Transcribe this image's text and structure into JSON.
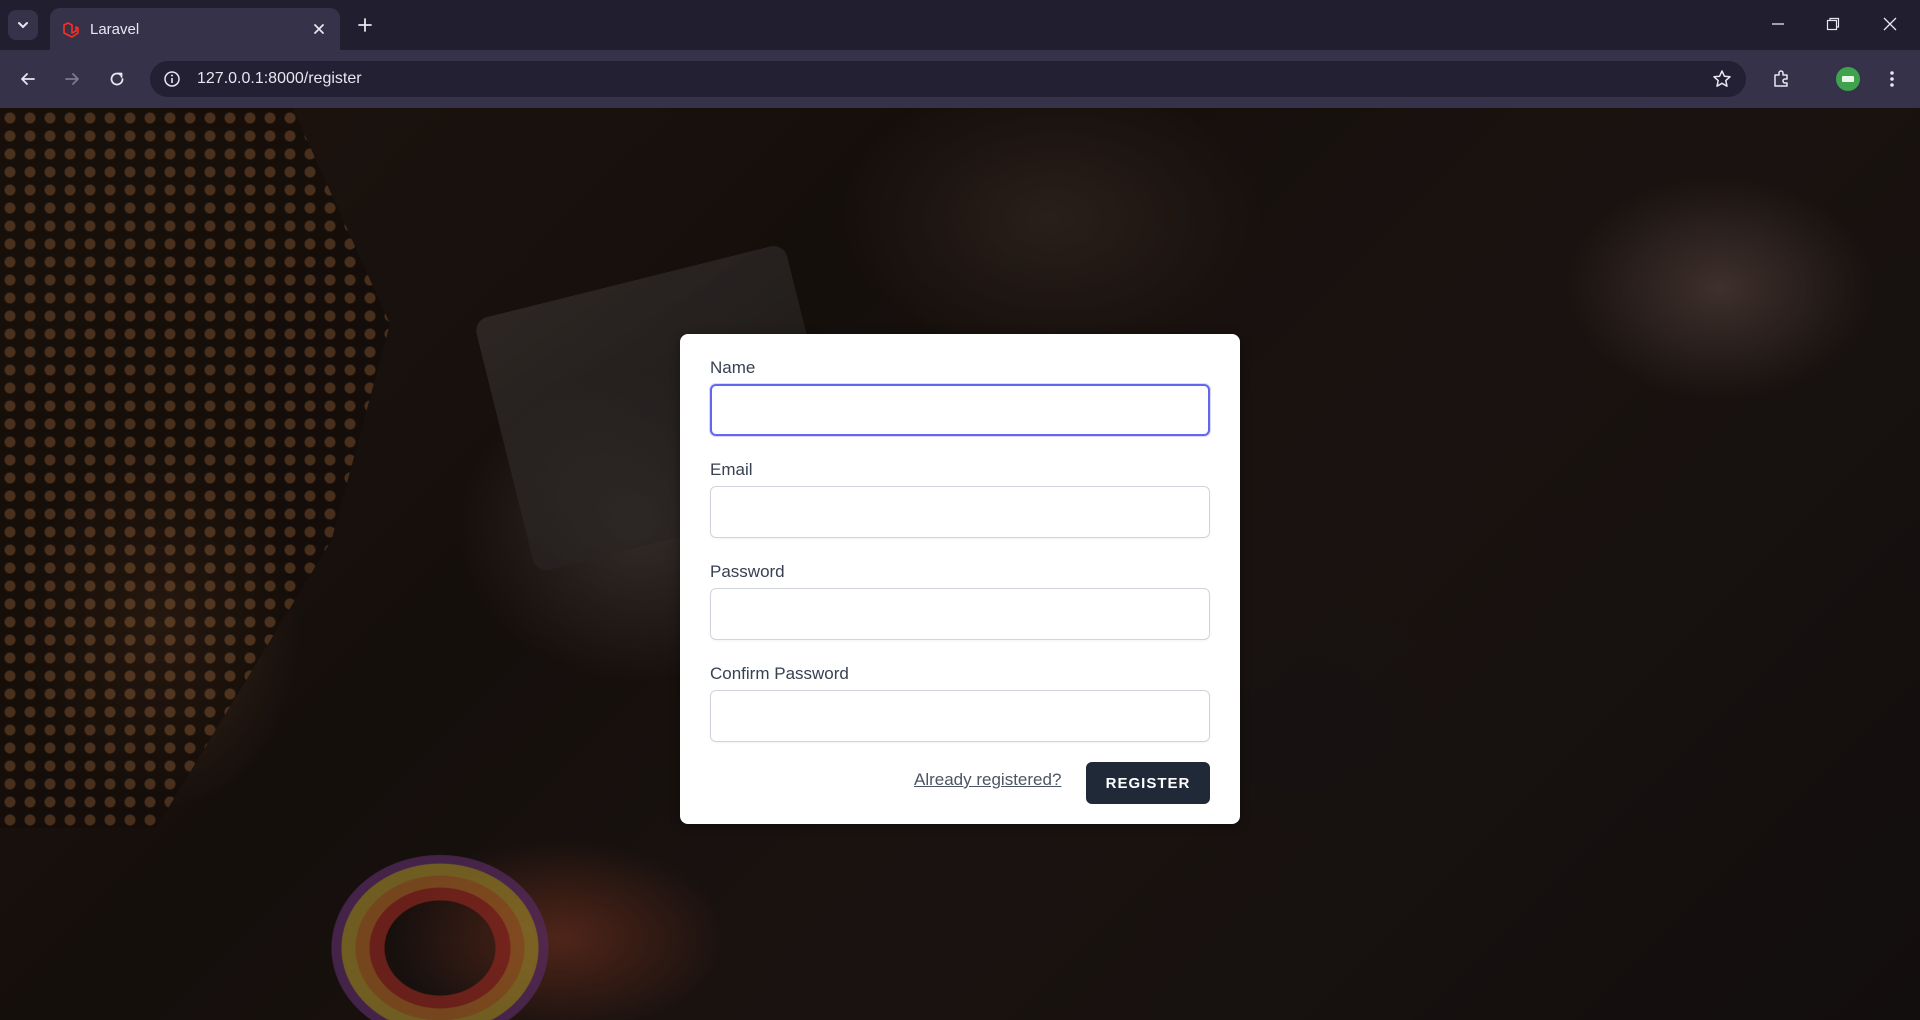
{
  "browser": {
    "tab_title": "Laravel",
    "url": "127.0.0.1:8000/register"
  },
  "form": {
    "name_label": "Name",
    "email_label": "Email",
    "password_label": "Password",
    "confirm_password_label": "Confirm Password",
    "name_value": "",
    "email_value": "",
    "password_value": "",
    "confirm_password_value": "",
    "already_registered_link": "Already registered?",
    "register_button": "REGISTER"
  },
  "colors": {
    "accent_focus": "#6366f1",
    "button_bg": "#1f2937",
    "favicon": "#ff2d20",
    "profile": "#3fa34d"
  },
  "icons": [
    "tab-search-icon",
    "laravel-favicon-icon",
    "close-icon",
    "plus-icon",
    "minimize-icon",
    "restore-icon",
    "window-close-icon",
    "back-arrow-icon",
    "forward-arrow-icon",
    "reload-icon",
    "site-info-icon",
    "star-icon",
    "extensions-icon",
    "profile-icon",
    "menu-icon"
  ]
}
